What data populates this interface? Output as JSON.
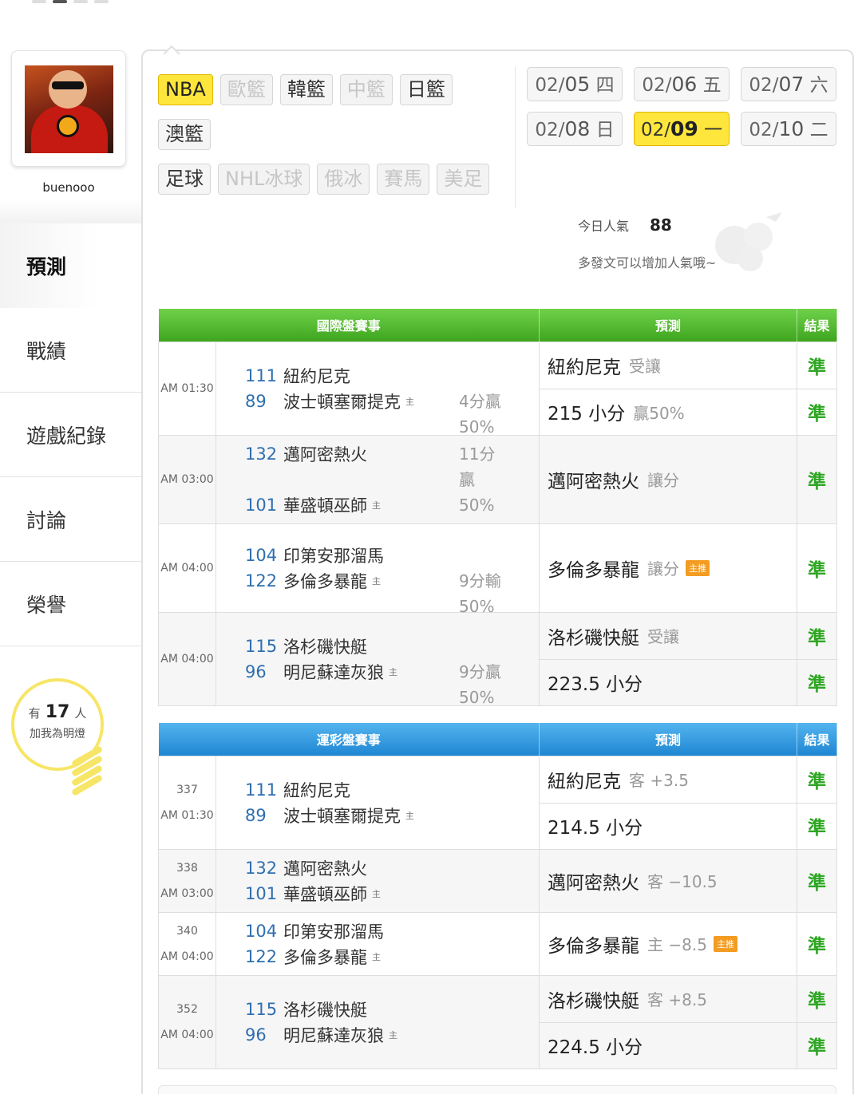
{
  "user": {
    "name": "buenooo"
  },
  "nav": {
    "items": [
      {
        "label": "預測",
        "active": true
      },
      {
        "label": "戰績",
        "active": false
      },
      {
        "label": "遊戲紀錄",
        "active": false
      },
      {
        "label": "討論",
        "active": false
      },
      {
        "label": "榮譽",
        "active": false
      }
    ]
  },
  "lamp": {
    "prefix": "有",
    "count": "17",
    "suffix": "人",
    "line2": "加我為明燈"
  },
  "leagues": {
    "row1": [
      {
        "label": "NBA",
        "state": "active"
      },
      {
        "label": "歐籃",
        "state": "dim"
      },
      {
        "label": "韓籃",
        "state": "normal"
      },
      {
        "label": "中籃",
        "state": "dim"
      },
      {
        "label": "日籃",
        "state": "normal"
      }
    ],
    "row2": [
      {
        "label": "澳籃",
        "state": "normal"
      }
    ],
    "row3": [
      {
        "label": "足球",
        "state": "normal"
      },
      {
        "label": "NHL冰球",
        "state": "dim"
      },
      {
        "label": "俄冰",
        "state": "dim"
      },
      {
        "label": "賽馬",
        "state": "dim"
      },
      {
        "label": "美足",
        "state": "dim"
      }
    ]
  },
  "dates": [
    {
      "md": "02/",
      "d": "05",
      "wd": "四",
      "active": false
    },
    {
      "md": "02/",
      "d": "06",
      "wd": "五",
      "active": false
    },
    {
      "md": "02/",
      "d": "07",
      "wd": "六",
      "active": false
    },
    {
      "md": "02/",
      "d": "08",
      "wd": "日",
      "active": false
    },
    {
      "md": "02/",
      "d": "09",
      "wd": "一",
      "active": true
    },
    {
      "md": "02/",
      "d": "10",
      "wd": "二",
      "active": false
    }
  ],
  "popularity": {
    "label": "今日人氣",
    "value": "88",
    "hint": "多發文可以增加人氣哦~"
  },
  "intl_table": {
    "headers": [
      "國際盤賽事",
      "預測",
      "結果"
    ],
    "games": [
      {
        "time": "AM 01:30",
        "away_score": "111",
        "away": "紐約尼克",
        "home_score": "89",
        "home": "波士頓塞爾提克",
        "result_line1": "4分贏",
        "result_line2": "50%",
        "picks": [
          {
            "main": "紐約尼克",
            "sub": "受讓",
            "tag": "",
            "res": "準"
          },
          {
            "main": "215 小分",
            "sub": "贏50%",
            "tag": "",
            "res": "準"
          }
        ]
      },
      {
        "time": "AM 03:00",
        "away_score": "132",
        "away": "邁阿密熱火",
        "home_score": "101",
        "home": "華盛頓巫師",
        "result_line1": "11分贏",
        "result_line2": "50%",
        "picks": [
          {
            "main": "邁阿密熱火",
            "sub": "讓分",
            "tag": "",
            "res": "準"
          }
        ]
      },
      {
        "time": "AM 04:00",
        "away_score": "104",
        "away": "印第安那溜馬",
        "home_score": "122",
        "home": "多倫多暴龍",
        "result_line1": "9分輸",
        "result_line2": "50%",
        "picks": [
          {
            "main": "多倫多暴龍",
            "sub": "讓分",
            "tag": "主推",
            "res": "準"
          }
        ]
      },
      {
        "time": "AM 04:00",
        "away_score": "115",
        "away": "洛杉磯快艇",
        "home_score": "96",
        "home": "明尼蘇達灰狼",
        "result_line1": "9分贏",
        "result_line2": "50%",
        "picks": [
          {
            "main": "洛杉磯快艇",
            "sub": "受讓",
            "tag": "",
            "res": "準"
          },
          {
            "main": "223.5 小分",
            "sub": "",
            "tag": "",
            "res": "準"
          }
        ]
      }
    ]
  },
  "lottery_table": {
    "headers": [
      "運彩盤賽事",
      "預測",
      "結果"
    ],
    "games": [
      {
        "no": "337",
        "time": "AM 01:30",
        "away_score": "111",
        "away": "紐約尼克",
        "home_score": "89",
        "home": "波士頓塞爾提克",
        "picks": [
          {
            "main": "紐約尼克",
            "sub": "客 +3.5",
            "tag": "",
            "res": "準"
          },
          {
            "main": "214.5 小分",
            "sub": "",
            "tag": "",
            "res": "準"
          }
        ]
      },
      {
        "no": "338",
        "time": "AM 03:00",
        "away_score": "132",
        "away": "邁阿密熱火",
        "home_score": "101",
        "home": "華盛頓巫師",
        "picks": [
          {
            "main": "邁阿密熱火",
            "sub": "客 −10.5",
            "tag": "",
            "res": "準"
          }
        ]
      },
      {
        "no": "340",
        "time": "AM 04:00",
        "away_score": "104",
        "away": "印第安那溜馬",
        "home_score": "122",
        "home": "多倫多暴龍",
        "picks": [
          {
            "main": "多倫多暴龍",
            "sub": "主 −8.5",
            "tag": "主推",
            "res": "準"
          }
        ]
      },
      {
        "no": "352",
        "time": "AM 04:00",
        "away_score": "115",
        "away": "洛杉磯快艇",
        "home_score": "96",
        "home": "明尼蘇達灰狼",
        "picks": [
          {
            "main": "洛杉磯快艇",
            "sub": "客 +8.5",
            "tag": "",
            "res": "準"
          },
          {
            "main": "224.5 小分",
            "sub": "",
            "tag": "",
            "res": "準"
          }
        ]
      }
    ]
  },
  "home_mark": "主"
}
